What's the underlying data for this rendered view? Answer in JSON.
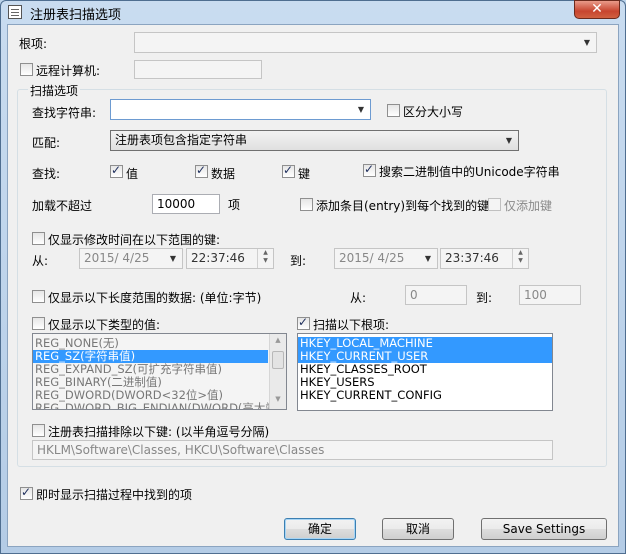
{
  "window": {
    "title": "注册表扫描选项",
    "close": "✕"
  },
  "root": {
    "label": "根项:",
    "value": ""
  },
  "remote": {
    "label": "远程计算机:",
    "value": ""
  },
  "scan_options": {
    "group_title": "扫描选项",
    "find_label": "查找字符串:",
    "find_value": "",
    "case_label": "区分大小写",
    "match_label": "匹配:",
    "match_value": "注册表项包含指定字符串",
    "search_label": "查找:",
    "search_values": "值",
    "search_data": "数据",
    "search_keys": "键",
    "search_unicode": "搜索二进制值中的Unicode字符串",
    "load_label": "加载不超过",
    "load_value": "10000",
    "load_unit": "项",
    "add_entry": "添加条目(entry)到每个找到的键",
    "add_only": "仅添加键",
    "time_filter": "仅显示修改时间在以下范围的键:",
    "from_label": "从:",
    "from_date": "2015/ 4/25",
    "from_time": "22:37:46",
    "to_label": "到:",
    "to_date": "2015/ 4/25",
    "to_time": "23:37:46",
    "len_filter": "仅显示以下长度范围的数据: (单位:字节)",
    "len_from_label": "从:",
    "len_from": "0",
    "len_to_label": "到:",
    "len_to": "100",
    "type_filter": "仅显示以下类型的值:",
    "types": [
      "REG_NONE(无)",
      "REG_SZ(字符串值)",
      "REG_EXPAND_SZ(可扩充字符串值)",
      "REG_BINARY(二进制值)",
      "REG_DWORD(DWORD<32位>值)",
      "REG_DWORD_BIG_ENDIAN(DWORD(高大端)"
    ],
    "scan_roots_label": "扫描以下根项:",
    "roots": [
      "HKEY_LOCAL_MACHINE",
      "HKEY_CURRENT_USER",
      "HKEY_CLASSES_ROOT",
      "HKEY_USERS",
      "HKEY_CURRENT_CONFIG"
    ],
    "exclude_label": "注册表扫描排除以下键: (以半角逗号分隔)",
    "exclude_value": "HKLM\\Software\\Classes, HKCU\\Software\\Classes"
  },
  "realtime_label": "即时显示扫描过程中找到的项",
  "buttons": {
    "ok": "确定",
    "cancel": "取消",
    "save": "Save Settings"
  },
  "checked": {
    "remote": false,
    "case": false,
    "values": true,
    "data": true,
    "keys": true,
    "unicode": true,
    "add_entry": false,
    "add_only": false,
    "time": false,
    "length": false,
    "types": false,
    "roots": true,
    "exclude": false,
    "realtime": true
  }
}
